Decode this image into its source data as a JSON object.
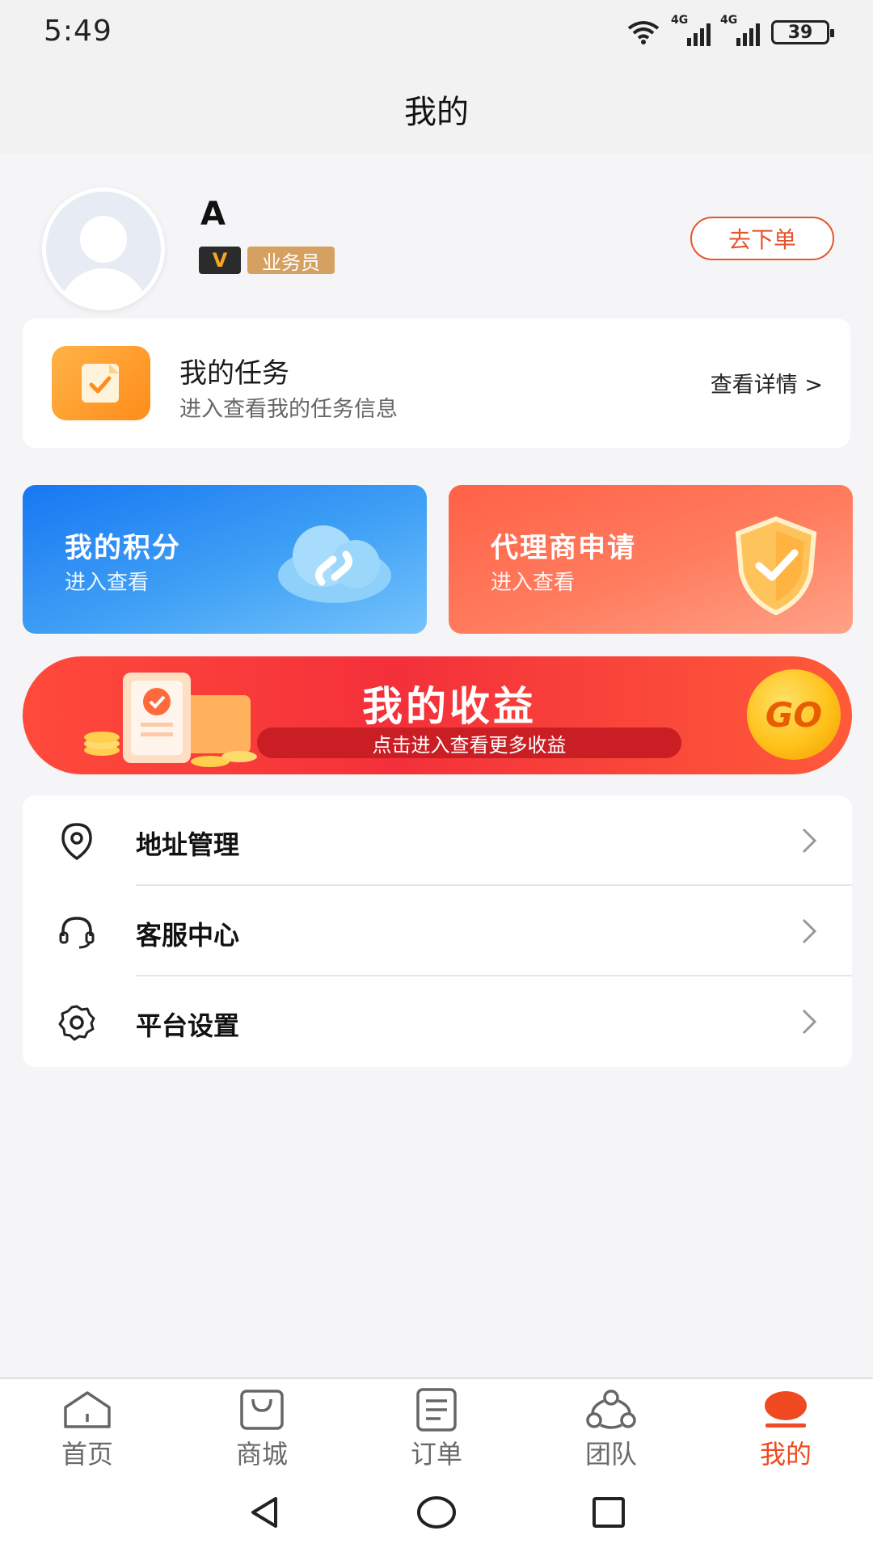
{
  "status_bar": {
    "time": "5:49",
    "network1": "4G",
    "network2": "4G",
    "battery": "39"
  },
  "header": {
    "title": "我的"
  },
  "profile": {
    "name": "A",
    "level_badge": "V",
    "role": "业务员",
    "order_button": "去下单"
  },
  "task": {
    "title": "我的任务",
    "subtitle": "进入查看我的任务信息",
    "detail_link": "查看详情 >"
  },
  "promos": {
    "points": {
      "title": "我的积分",
      "subtitle": "进入查看"
    },
    "agent": {
      "title": "代理商申请",
      "subtitle": "进入查看"
    }
  },
  "earnings": {
    "title": "我的收益",
    "subtitle": "点击进入查看更多收益",
    "go": "GO"
  },
  "menu": [
    {
      "label": "地址管理",
      "icon": "location-pin-icon"
    },
    {
      "label": "客服中心",
      "icon": "headset-icon"
    },
    {
      "label": "平台设置",
      "icon": "gear-icon"
    }
  ],
  "tabbar": {
    "items": [
      {
        "label": "首页",
        "icon": "home-icon",
        "active": false
      },
      {
        "label": "商城",
        "icon": "shopping-bag-icon",
        "active": false
      },
      {
        "label": "订单",
        "icon": "order-list-icon",
        "active": false
      },
      {
        "label": "团队",
        "icon": "team-icon",
        "active": false
      },
      {
        "label": "我的",
        "icon": "profile-icon",
        "active": true
      }
    ]
  },
  "colors": {
    "accent": "#f04a22",
    "points_card": "#1877f2",
    "agent_card": "#ff6147",
    "earnings_banner": "#f4303a",
    "role_badge": "#d5a060"
  }
}
